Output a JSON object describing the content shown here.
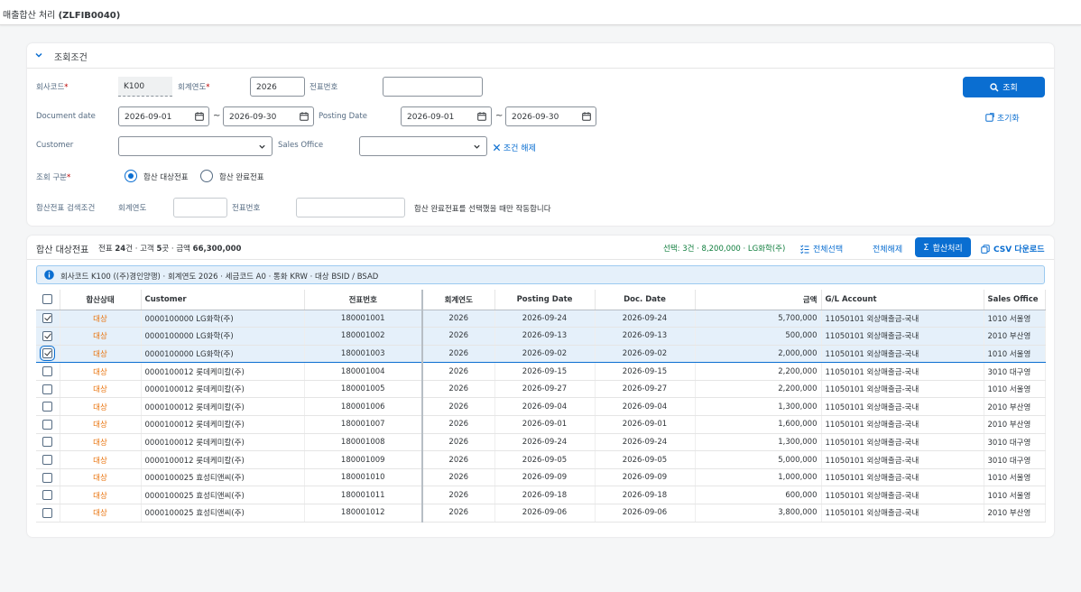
{
  "shell": {
    "title_prefix": "매출합산 처리 ",
    "title_code": "(ZLFIB0040)"
  },
  "filter": {
    "header": "조회조건",
    "company_code": {
      "label": "회사코드",
      "value": "K100"
    },
    "fiscal_year": {
      "label": "회계연도",
      "value": "2026"
    },
    "doc_no": {
      "label": "전표번호",
      "value": ""
    },
    "doc_date": {
      "label": "Document date",
      "from": "2026-09-01",
      "to": "2026-09-30"
    },
    "posting_date": {
      "label": "Posting Date",
      "from": "2026-09-01",
      "to": "2026-09-30"
    },
    "customer": {
      "label": "Customer",
      "value": ""
    },
    "sales_office": {
      "label": "Sales Office",
      "value": ""
    },
    "clear_conditions": "조건 해제",
    "query_type": {
      "label": "조회 구분",
      "opt1": "합산 대상전표",
      "opt2": "합산 완료전표",
      "selected": "합산 대상전표"
    },
    "sum_search": {
      "label": "합산전표 검색조건",
      "year_label": "회계연도",
      "year_value": "",
      "doc_label": "전표번호",
      "doc_value": "",
      "hint": "합산 완료전표를 선택했을 때만 작동합니다"
    },
    "search_button": "조회",
    "reset_button": "초기화",
    "tilde": "~"
  },
  "results": {
    "title": "합산 대상전표",
    "sum_prefix": "전표 ",
    "doc_count": "24",
    "sum_mid1": "건 · 고객 ",
    "cust_count": "5",
    "sum_mid2": "곳 · 금액 ",
    "amount": "66,300,000",
    "selection_info": "선택: 3건 · 8,200,000 · LG화학(주)",
    "btn_select_all": "전체선택",
    "btn_deselect_all": "전체해제",
    "btn_process": "합산처리",
    "btn_csv": "CSV 다운로드",
    "message": "회사코드 K100 ((주)경인양행) · 회계연도 2026 · 세금코드 A0 · 통화 KRW · 대상 BSID / BSAD",
    "columns": [
      "합산상태",
      "Customer",
      "전표번호",
      "회계연도",
      "Posting Date",
      "Doc. Date",
      "금액",
      "G/L Account",
      "Sales Office"
    ],
    "rows": [
      {
        "checked": true,
        "status": "대상",
        "customer": "0000100000 LG화학(주)",
        "doc": "180001001",
        "year": "2026",
        "posting": "2026-09-24",
        "docdate": "2026-09-24",
        "amount": "5,700,000",
        "gl": "11050101 외상매출금-국내",
        "office": "1010 서울영"
      },
      {
        "checked": true,
        "status": "대상",
        "customer": "0000100000 LG화학(주)",
        "doc": "180001002",
        "year": "2026",
        "posting": "2026-09-13",
        "docdate": "2026-09-13",
        "amount": "500,000",
        "gl": "11050101 외상매출금-국내",
        "office": "2010 부산영"
      },
      {
        "checked": true,
        "status": "대상",
        "customer": "0000100000 LG화학(주)",
        "doc": "180001003",
        "year": "2026",
        "posting": "2026-09-02",
        "docdate": "2026-09-02",
        "amount": "2,000,000",
        "gl": "11050101 외상매출금-국내",
        "office": "1010 서울영"
      },
      {
        "checked": false,
        "status": "대상",
        "customer": "0000100012 롯데케미칼(주)",
        "doc": "180001004",
        "year": "2026",
        "posting": "2026-09-15",
        "docdate": "2026-09-15",
        "amount": "2,200,000",
        "gl": "11050101 외상매출금-국내",
        "office": "3010 대구영"
      },
      {
        "checked": false,
        "status": "대상",
        "customer": "0000100012 롯데케미칼(주)",
        "doc": "180001005",
        "year": "2026",
        "posting": "2026-09-27",
        "docdate": "2026-09-27",
        "amount": "2,200,000",
        "gl": "11050101 외상매출금-국내",
        "office": "1010 서울영"
      },
      {
        "checked": false,
        "status": "대상",
        "customer": "0000100012 롯데케미칼(주)",
        "doc": "180001006",
        "year": "2026",
        "posting": "2026-09-04",
        "docdate": "2026-09-04",
        "amount": "1,300,000",
        "gl": "11050101 외상매출금-국내",
        "office": "2010 부산영"
      },
      {
        "checked": false,
        "status": "대상",
        "customer": "0000100012 롯데케미칼(주)",
        "doc": "180001007",
        "year": "2026",
        "posting": "2026-09-01",
        "docdate": "2026-09-01",
        "amount": "1,600,000",
        "gl": "11050101 외상매출금-국내",
        "office": "2010 부산영"
      },
      {
        "checked": false,
        "status": "대상",
        "customer": "0000100012 롯데케미칼(주)",
        "doc": "180001008",
        "year": "2026",
        "posting": "2026-09-24",
        "docdate": "2026-09-24",
        "amount": "1,300,000",
        "gl": "11050101 외상매출금-국내",
        "office": "3010 대구영"
      },
      {
        "checked": false,
        "status": "대상",
        "customer": "0000100012 롯데케미칼(주)",
        "doc": "180001009",
        "year": "2026",
        "posting": "2026-09-05",
        "docdate": "2026-09-05",
        "amount": "5,000,000",
        "gl": "11050101 외상매출금-국내",
        "office": "3010 대구영"
      },
      {
        "checked": false,
        "status": "대상",
        "customer": "0000100025 효성티앤씨(주)",
        "doc": "180001010",
        "year": "2026",
        "posting": "2026-09-09",
        "docdate": "2026-09-09",
        "amount": "1,000,000",
        "gl": "11050101 외상매출금-국내",
        "office": "1010 서울영"
      },
      {
        "checked": false,
        "status": "대상",
        "customer": "0000100025 효성티앤씨(주)",
        "doc": "180001011",
        "year": "2026",
        "posting": "2026-09-18",
        "docdate": "2026-09-18",
        "amount": "600,000",
        "gl": "11050101 외상매출금-국내",
        "office": "1010 서울영"
      },
      {
        "checked": false,
        "status": "대상",
        "customer": "0000100025 효성티앤씨(주)",
        "doc": "180001012",
        "year": "2026",
        "posting": "2026-09-06",
        "docdate": "2026-09-06",
        "amount": "3,800,000",
        "gl": "11050101 외상매출금-국내",
        "office": "2010 부산영"
      }
    ]
  },
  "colors": {
    "accent": "#0a6ed1",
    "status_target": "#e9730c",
    "selection": "#e5f0fa",
    "positive": "#107e3e"
  }
}
